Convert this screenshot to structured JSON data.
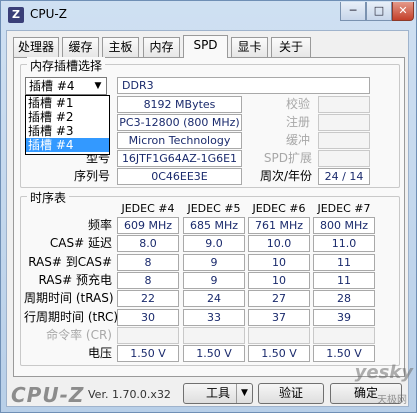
{
  "window": {
    "title": "CPU-Z",
    "icon_letter": "Z",
    "min_label": "─",
    "max_label": "□",
    "close_label": "✕"
  },
  "tabs": [
    "处理器",
    "缓存",
    "主板",
    "内存",
    "SPD",
    "显卡",
    "关于"
  ],
  "active_tab": "SPD",
  "slot_section": {
    "title": "内存插槽选择",
    "selected_slot": "插槽 #4",
    "dropdown_options": [
      "插槽 #1",
      "插槽 #2",
      "插槽 #3",
      "插槽 #4"
    ],
    "memory_type": "DDR3",
    "module_size": "8192 MBytes",
    "max_bandwidth": "PC3-12800 (800 MHz)",
    "manufacturer": "Micron Technology",
    "part_number": "16JTF1G64AZ-1G6E1",
    "serial_number": "0C46EE3E",
    "labels": {
      "part_number": "型号",
      "serial_number": "序列号",
      "correction": "校验",
      "registered": "注册",
      "buffered": "缓冲",
      "spd_ext": "SPD扩展",
      "week_year": "周次/年份"
    },
    "week_year": "24 / 14"
  },
  "timings": {
    "title": "时序表",
    "columns": [
      "JEDEC #4",
      "JEDEC #5",
      "JEDEC #6",
      "JEDEC #7"
    ],
    "rows": [
      {
        "label": "频率",
        "values": [
          "609 MHz",
          "685 MHz",
          "761 MHz",
          "800 MHz"
        ]
      },
      {
        "label": "CAS# 延迟",
        "values": [
          "8.0",
          "9.0",
          "10.0",
          "11.0"
        ]
      },
      {
        "label": "RAS# 到CAS#",
        "values": [
          "8",
          "9",
          "10",
          "11"
        ]
      },
      {
        "label": "RAS# 预充电",
        "values": [
          "8",
          "9",
          "10",
          "11"
        ]
      },
      {
        "label": "周期时间 (tRAS)",
        "values": [
          "22",
          "24",
          "27",
          "28"
        ]
      },
      {
        "label": "行周期时间 (tRC)",
        "values": [
          "30",
          "33",
          "37",
          "39"
        ]
      },
      {
        "label": "命令率 (CR)",
        "values": [
          "",
          "",
          "",
          ""
        ]
      },
      {
        "label": "电压",
        "values": [
          "1.50 V",
          "1.50 V",
          "1.50 V",
          "1.50 V"
        ]
      }
    ]
  },
  "footer": {
    "logo": "CPU-Z",
    "version": "Ver. 1.70.0.x32",
    "tools_label": "工具",
    "validate_label": "验证",
    "ok_label": "确定",
    "watermark": "yesky",
    "watermark_sub": "天极网"
  }
}
